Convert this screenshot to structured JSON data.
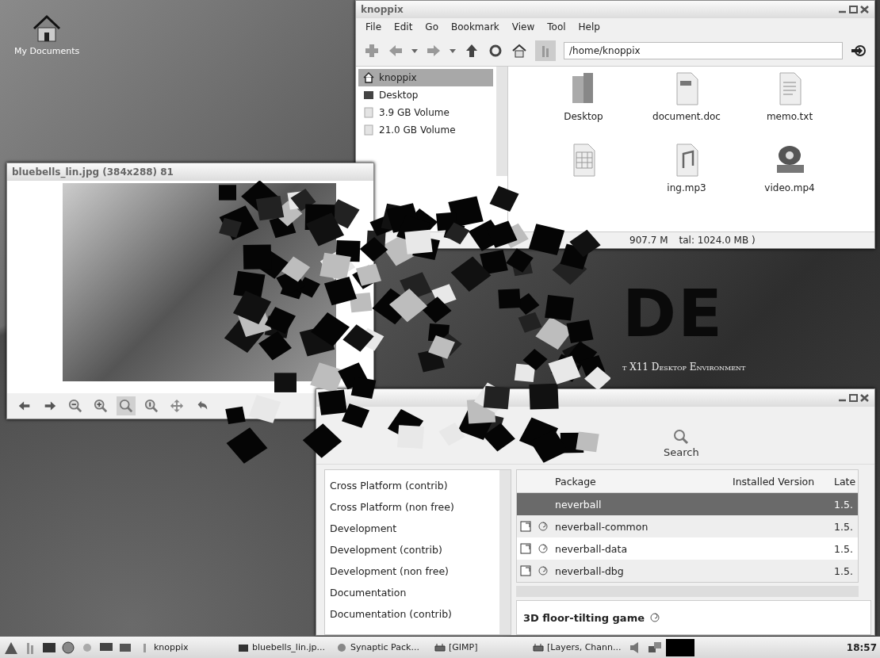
{
  "desktop": {
    "icons": [
      {
        "label": "My Documents"
      }
    ],
    "logo": {
      "mark": "DE",
      "subtitle": "t X11 Desktop Environment"
    }
  },
  "file_manager": {
    "title": "knoppix",
    "menu": [
      "File",
      "Edit",
      "Go",
      "Bookmark",
      "View",
      "Tool",
      "Help"
    ],
    "path": "/home/knoppix",
    "places": [
      {
        "label": "knoppix",
        "kind": "home",
        "selected": true
      },
      {
        "label": "Desktop",
        "kind": "desktop",
        "selected": false
      },
      {
        "label": "3.9 GB Volume",
        "kind": "drive",
        "selected": false
      },
      {
        "label": "21.0 GB Volume",
        "kind": "drive",
        "selected": false
      }
    ],
    "files": [
      {
        "label": "Desktop",
        "kind": "folder"
      },
      {
        "label": "document.doc",
        "kind": "document"
      },
      {
        "label": "memo.txt",
        "kind": "text"
      },
      {
        "kind": "spreadsheet"
      },
      {
        "label": "ing.mp3",
        "kind": "audio"
      },
      {
        "label": "video.mp4",
        "kind": "video"
      }
    ],
    "status": [
      "907.7 M",
      "tal: 1024.0 MB )"
    ]
  },
  "image_viewer": {
    "title": "bluebells_lin.jpg (384x288) 81",
    "tools": [
      {
        "kind": "previous",
        "selected": false
      },
      {
        "kind": "next",
        "selected": false
      },
      {
        "kind": "zoom-out",
        "selected": false
      },
      {
        "kind": "zoom-in",
        "selected": false
      },
      {
        "kind": "zoom-fit",
        "selected": true
      },
      {
        "kind": "zoom-original",
        "selected": false
      },
      {
        "kind": "fullscreen",
        "selected": false
      },
      {
        "kind": "rotate",
        "selected": false
      }
    ]
  },
  "package_manager": {
    "toolbar": [
      {
        "label": "Search"
      }
    ],
    "categories": [
      "Cross Platform (contrib)",
      "Cross Platform (non free)",
      "Development",
      "Development (contrib)",
      "Development (non free)",
      "Documentation",
      "Documentation (contrib)"
    ],
    "columns": [
      "Package",
      "Installed Version",
      "Late"
    ],
    "rows": [
      {
        "package": "neverball",
        "latest": "1.5.",
        "selected": true
      },
      {
        "package": "neverball-common",
        "latest": "1.5.",
        "selected": false
      },
      {
        "package": "neverball-data",
        "latest": "1.5.",
        "selected": false
      },
      {
        "package": "neverball-dbg",
        "latest": "1.5.",
        "selected": false
      }
    ],
    "description": "3D floor-tilting game"
  },
  "taskbar": {
    "tasks": [
      {
        "label": "knoppix",
        "kind": "folder"
      },
      {
        "label": "bluebells_lin.jp...",
        "kind": "image"
      },
      {
        "label": "Synaptic Pack...",
        "kind": "package"
      },
      {
        "label": "[GIMP]",
        "kind": "gimp"
      },
      {
        "label": "[Layers, Chann...",
        "kind": "gimp"
      }
    ],
    "clock": "18:57"
  }
}
